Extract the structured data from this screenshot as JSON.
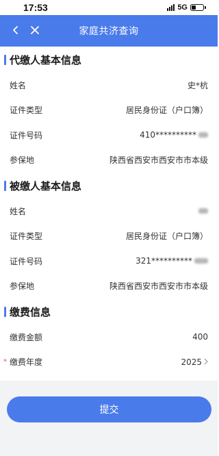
{
  "status_bar": {
    "time": "17:53",
    "network": "5G"
  },
  "nav": {
    "title": "家庭共济查询",
    "back_icon": "chevron-left-icon",
    "close_icon": "close-icon",
    "bar_color": "#4a7bea"
  },
  "payer_section": {
    "title": "代缴人基本信息",
    "rows": [
      {
        "label": "姓名",
        "value": "史*杭"
      },
      {
        "label": "证件类型",
        "value": "居民身份证（户口簿）"
      },
      {
        "label": "证件号码",
        "value": "410**********"
      },
      {
        "label": "参保地",
        "value": "陕西省西安市西安市市本级"
      }
    ]
  },
  "payee_section": {
    "title": "被缴人基本信息",
    "rows": [
      {
        "label": "姓名",
        "value": ""
      },
      {
        "label": "证件类型",
        "value": "居民身份证（户口簿）"
      },
      {
        "label": "证件号码",
        "value": "321**********"
      },
      {
        "label": "参保地",
        "value": "陕西省西安市西安市市本级"
      }
    ]
  },
  "fee_section": {
    "title": "缴费信息",
    "amount_label": "缴费金额",
    "amount_value": "400",
    "year_label": "缴费年度",
    "year_value": "2025",
    "required_mark": "*"
  },
  "submit_label": "提交"
}
